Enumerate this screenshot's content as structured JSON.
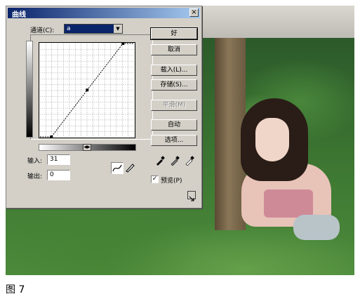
{
  "caption": "图 7",
  "dialog": {
    "title": "曲线",
    "close_glyph": "×",
    "channel": {
      "label": "通道(C):",
      "value": "a"
    },
    "input": {
      "label": "输入:",
      "value": "31"
    },
    "output": {
      "label": "输出:",
      "value": "0"
    },
    "buttons": {
      "ok": "好",
      "cancel": "取消",
      "load": "载入(L)...",
      "save": "存储(S)...",
      "smooth": "平滑(M)",
      "auto": "自动",
      "options": "选项..."
    },
    "preview": {
      "label": "预览(P)",
      "checked": true,
      "check_glyph": "✓"
    },
    "curve_points": [
      {
        "input": 31,
        "output": 0
      },
      {
        "input": 128,
        "output": 128
      },
      {
        "input": 225,
        "output": 255
      }
    ],
    "colors": {
      "accent": "#0a246a",
      "face": "#d4d0c8"
    }
  }
}
